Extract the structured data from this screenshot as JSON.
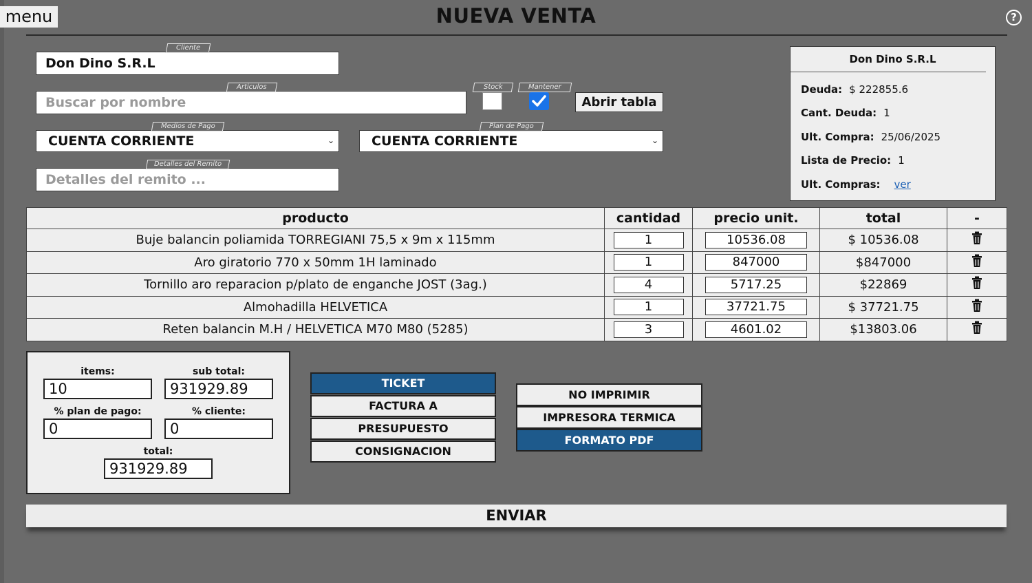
{
  "header": {
    "menu_label": "menu",
    "title": "NUEVA VENTA",
    "help_icon": "question-circle-icon"
  },
  "form": {
    "cliente": {
      "tag": "Cliente",
      "value": "Don Dino S.R.L"
    },
    "articulos": {
      "tag": "Articulos",
      "placeholder": "Buscar por nombre"
    },
    "stock": {
      "tag": "Stock",
      "checked": false
    },
    "mantener": {
      "tag": "Mantener",
      "checked": true
    },
    "abrir_tabla_label": "Abrir tabla",
    "medios_pago": {
      "tag": "Medios de Pago",
      "value": "CUENTA CORRIENTE"
    },
    "plan_pago": {
      "tag": "Plan de Pago",
      "value": "CUENTA CORRIENTE"
    },
    "detalles": {
      "tag": "Detalles del Remito",
      "placeholder": "Detalles del remito ..."
    }
  },
  "client_card": {
    "name": "Don Dino S.R.L",
    "deuda_label": "Deuda:",
    "deuda_value": "$ 222855.6",
    "cant_deuda_label": "Cant. Deuda:",
    "cant_deuda_value": "1",
    "ult_compra_label": "Ult. Compra:",
    "ult_compra_value": "25/06/2025",
    "lista_precio_label": "Lista de Precio:",
    "lista_precio_value": "1",
    "ult_compras_label": "Ult. Compras:",
    "ult_compras_link": "ver"
  },
  "table": {
    "headers": [
      "producto",
      "cantidad",
      "precio unit.",
      "total",
      "-"
    ],
    "rows": [
      {
        "producto": "Buje balancin poliamida TORREGIANI 75,5 x 9m x 115mm",
        "cantidad": "1",
        "precio": "10536.08",
        "total": "$ 10536.08"
      },
      {
        "producto": "Aro giratorio 770 x 50mm 1H laminado",
        "cantidad": "1",
        "precio": "847000",
        "total": "$847000"
      },
      {
        "producto": "Tornillo aro reparacion p/plato de enganche JOST (3ag.)",
        "cantidad": "4",
        "precio": "5717.25",
        "total": "$22869"
      },
      {
        "producto": "Almohadilla HELVETICA",
        "cantidad": "1",
        "precio": "37721.75",
        "total": "$ 37721.75"
      },
      {
        "producto": "Reten balancin M.H / HELVETICA M70 M80 (5285)",
        "cantidad": "3",
        "precio": "4601.02",
        "total": "$13803.06"
      }
    ]
  },
  "totals": {
    "items_label": "items:",
    "items_value": "10",
    "subtotal_label": "sub total:",
    "subtotal_value": "931929.89",
    "plan_label": "% plan de pago:",
    "plan_value": "0",
    "cliente_label": "% cliente:",
    "cliente_value": "0",
    "total_label": "total:",
    "total_value": "931929.89"
  },
  "doc_types": [
    {
      "label": "TICKET",
      "active": true
    },
    {
      "label": "FACTURA A",
      "active": false
    },
    {
      "label": "PRESUPUESTO",
      "active": false
    },
    {
      "label": "CONSIGNACION",
      "active": false
    }
  ],
  "print_options": [
    {
      "label": "NO IMPRIMIR",
      "active": false
    },
    {
      "label": "IMPRESORA TERMICA",
      "active": false
    },
    {
      "label": "FORMATO PDF",
      "active": true
    }
  ],
  "enviar_label": "ENVIAR",
  "colors": {
    "background": "#6b6b6b",
    "panel": "#eeeeee",
    "active": "#1e5a8c",
    "checkbox": "#1a73e8",
    "link": "#1a5fb4"
  }
}
